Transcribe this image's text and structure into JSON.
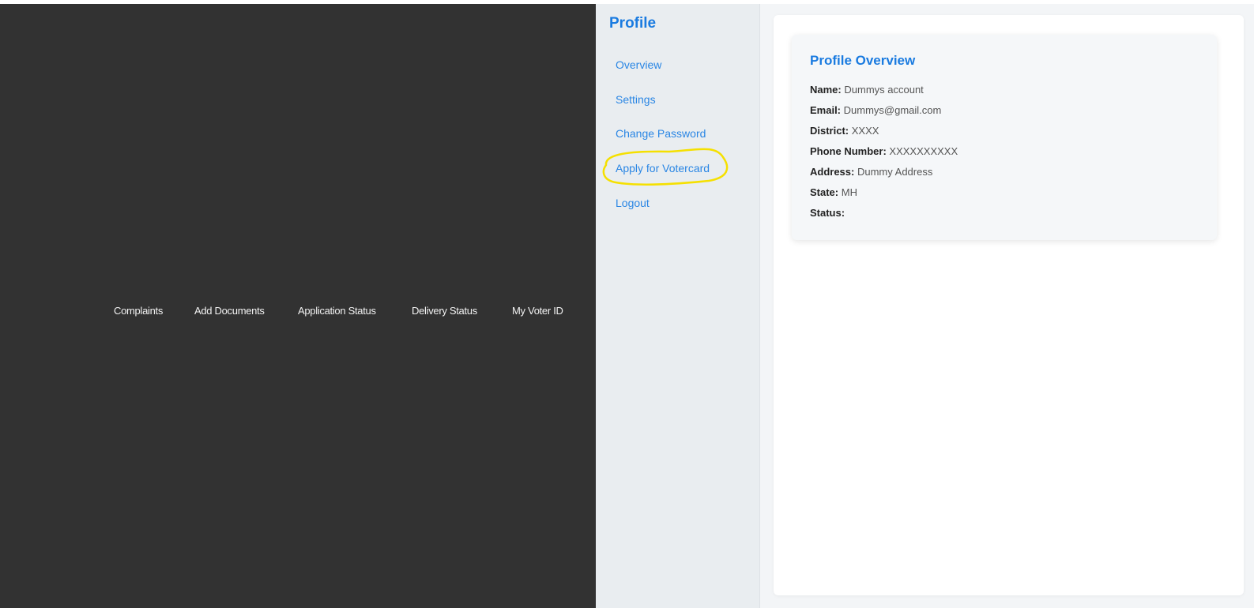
{
  "top_nav": {
    "items": [
      {
        "label": "Complaints"
      },
      {
        "label": "Add Documents"
      },
      {
        "label": "Application Status"
      },
      {
        "label": "Delivery Status"
      },
      {
        "label": "My Voter ID"
      }
    ]
  },
  "sidebar": {
    "title": "Profile",
    "items": [
      {
        "label": "Overview"
      },
      {
        "label": "Settings"
      },
      {
        "label": "Change Password"
      },
      {
        "label": "Apply for Votercard"
      },
      {
        "label": "Logout"
      }
    ],
    "highlighted_item": "Apply for Votercard",
    "highlight_color": "#f5e000"
  },
  "overview": {
    "title": "Profile Overview",
    "fields": [
      {
        "label": "Name:",
        "value": "Dummys account"
      },
      {
        "label": "Email:",
        "value": "Dummys@gmail.com"
      },
      {
        "label": "District:",
        "value": "XXXX"
      },
      {
        "label": "Phone Number:",
        "value": "XXXXXXXXXX"
      },
      {
        "label": "Address:",
        "value": "Dummy Address"
      },
      {
        "label": "State:",
        "value": "MH"
      },
      {
        "label": "Status:",
        "value": ""
      }
    ]
  },
  "colors": {
    "dark_panel": "#323232",
    "accent": "#1a7be0",
    "sidebar_bg": "#e9edf0"
  }
}
